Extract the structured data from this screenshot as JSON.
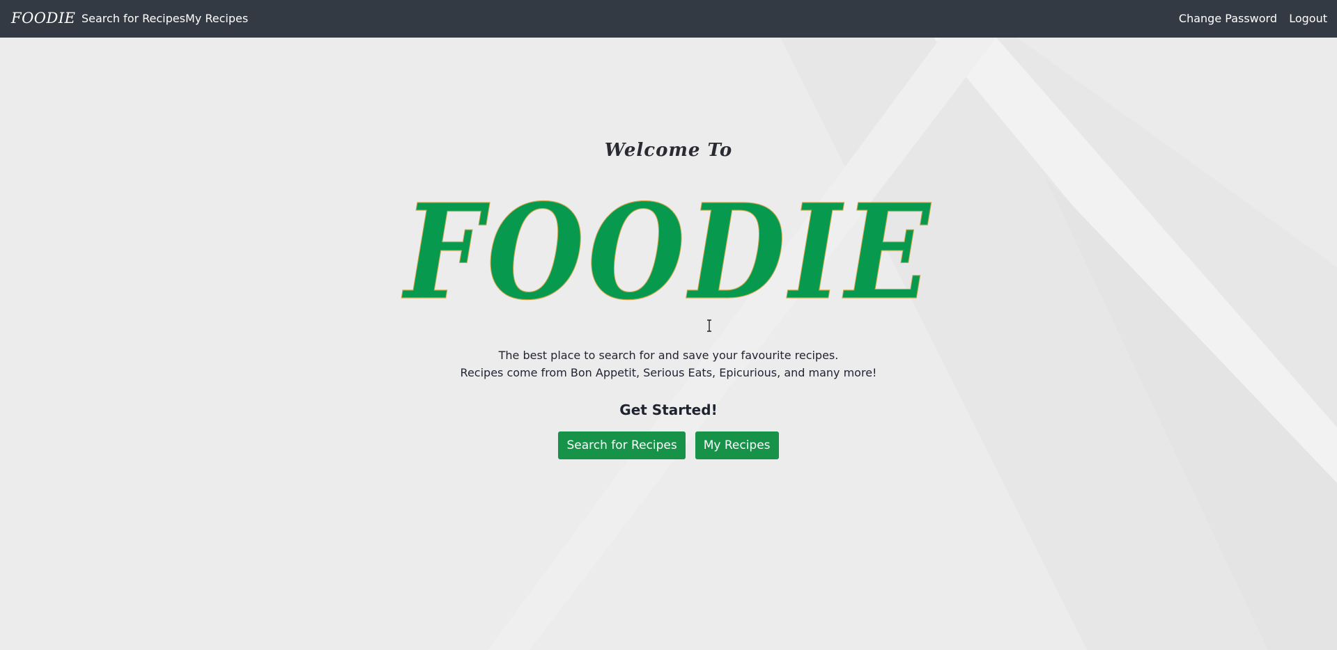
{
  "navbar": {
    "brand": "FOODIE",
    "links": {
      "search": "Search for Recipes",
      "my_recipes": "My Recipes",
      "change_password": "Change Password",
      "logout": "Logout"
    }
  },
  "hero": {
    "welcome": "Welcome To",
    "logo_text": "FOODIE",
    "tagline_line1": "The best place to search for and save your favourite recipes.",
    "tagline_line2": "Recipes come from Bon Appetit, Serious Eats, Epicurious, and many more!",
    "get_started": "Get Started!",
    "buttons": {
      "search": "Search for Recipes",
      "my_recipes": "My Recipes"
    }
  },
  "colors": {
    "navbar_bg": "#343a43",
    "page_bg": "#ececec",
    "accent_green": "#169348",
    "logo_green": "#079a4f"
  },
  "icons": {
    "cursor": "text-cursor-icon"
  }
}
